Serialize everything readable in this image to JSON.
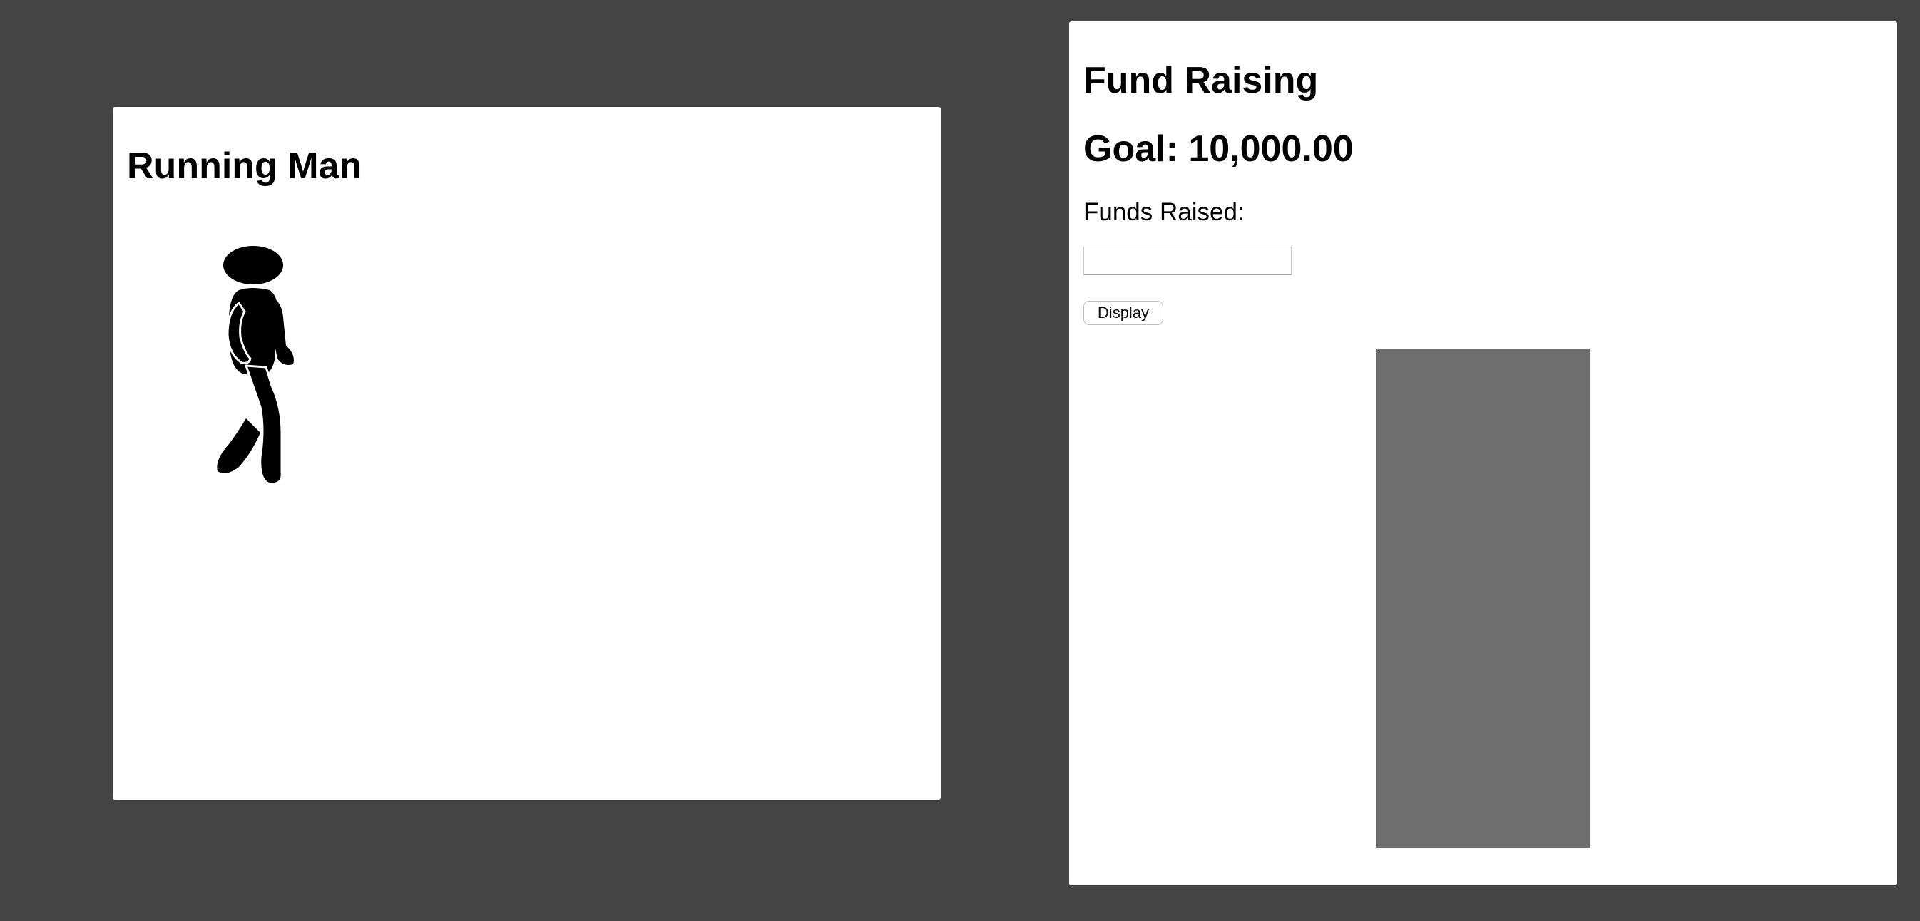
{
  "runner_panel": {
    "title": "Running Man",
    "figure_icon": "walking-person-icon"
  },
  "fund_panel": {
    "title": "Fund Raising",
    "goal_label": "Goal: 10,000.00",
    "funds_label": "Funds Raised:",
    "funds_input": {
      "value": "",
      "placeholder": ""
    },
    "display_button_label": "Display",
    "progress": {
      "fraction": 0,
      "fill_color": "#2e7d32",
      "empty_color": "#6e6e6e"
    }
  },
  "colors": {
    "background": "#444444",
    "card": "#ffffff",
    "text": "#000000"
  }
}
